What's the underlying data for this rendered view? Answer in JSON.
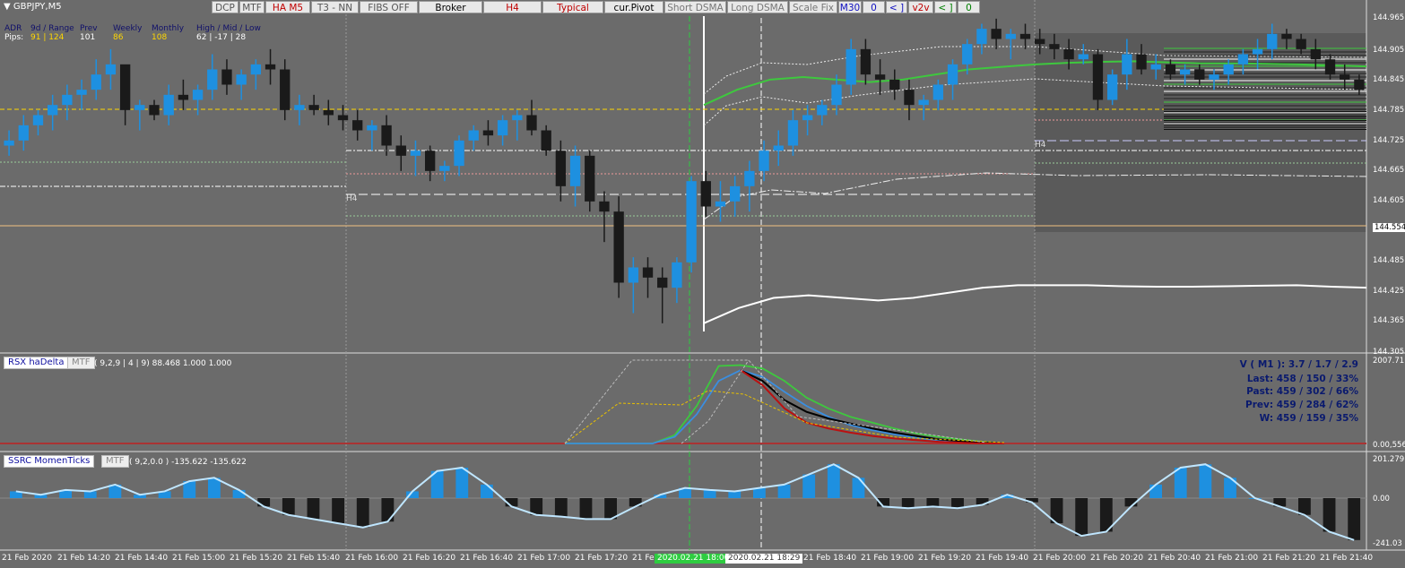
{
  "title": "GBPJPY,M5",
  "toolbar": [
    {
      "label": "DCP",
      "color": "#555555"
    },
    {
      "label": "MTF",
      "color": "#555555"
    },
    {
      "label": "HA M5",
      "color": "#c00000"
    },
    {
      "label": "T3 - NN",
      "color": "#555555"
    },
    {
      "label": "FIBS OFF",
      "color": "#555555"
    },
    {
      "label": "Broker",
      "color": "#000000"
    },
    {
      "label": "H4",
      "color": "#c00000"
    },
    {
      "label": "Typical",
      "color": "#c00000"
    },
    {
      "label": "cur.Pivot",
      "color": "#000000"
    },
    {
      "label": "Short DSMA",
      "color": "#777777"
    },
    {
      "label": "Long DSMA",
      "color": "#777777"
    },
    {
      "label": "Scale Fix",
      "color": "#777777"
    },
    {
      "label": "M30",
      "color": "#1010c0"
    },
    {
      "label": "0",
      "color": "#1010c0"
    },
    {
      "label": "< ]",
      "color": "#1010c0"
    },
    {
      "label": "v2v",
      "color": "#c00000"
    },
    {
      "label": "< ]",
      "color": "#008000"
    },
    {
      "label": "0",
      "color": "#008000"
    }
  ],
  "adr": {
    "row1": [
      "ADR",
      "9d / Range",
      "Prev",
      "Weekly",
      "Monthly",
      "High / Mid / Low"
    ],
    "row2": [
      "Pips:",
      "91 | 124",
      "101",
      "86",
      "108",
      "62 | -17 | 28"
    ]
  },
  "h4_labels": [
    "H4",
    "H4"
  ],
  "price_axis": [
    "144.965",
    "144.905",
    "144.845",
    "144.785",
    "144.725",
    "144.665",
    "144.605",
    "144.554",
    "144.485",
    "144.425",
    "144.365",
    "144.305"
  ],
  "rsx": {
    "label": "RSX haDelta",
    "mtf": "MTF",
    "params": "( 9,2,9 | 4 | 9) 88.468 1.000 1.000",
    "axis_top": "2007.711",
    "axis_bottom": "0.00,556",
    "stats": [
      "V ( M1 ): 3.7 / 1.7 / 2.9",
      "Last: 458 / 150 / 33%",
      "Past: 459 / 302 / 66%",
      "Prev: 459 / 284 / 62%",
      "W: 459 / 159 / 35%"
    ]
  },
  "ssrc": {
    "label": "SSRC MomenTicks",
    "mtf": "MTF",
    "params": "( 9,2,0.0 ) -135.622 -135.622",
    "axis": [
      "201.279",
      "0.00",
      "-241.03"
    ]
  },
  "time_axis": [
    "21 Feb 2020",
    "21 Feb 14:20",
    "21 Feb 14:40",
    "21 Feb 15:00",
    "21 Feb 15:20",
    "21 Feb 15:40",
    "21 Feb 16:00",
    "21 Feb 16:20",
    "21 Feb 16:40",
    "21 Feb 17:00",
    "21 Feb 17:20",
    "21 Feb",
    "21 Feb 18:40",
    "21 Feb 19:00",
    "21 Feb 19:20",
    "21 Feb 19:40",
    "21 Feb 20:00",
    "21 Feb 20:20",
    "21 Feb 20:40",
    "21 Feb 21:00",
    "21 Feb 21:20",
    "21 Feb 21:40"
  ],
  "time_markers": [
    "2020.02.21 18:00",
    "2020.02.21 18:29"
  ],
  "colors": {
    "bull": "#1e90e0",
    "bear": "#1a1a1a",
    "bg": "#6b6b6b",
    "dsma": "#3ec83e"
  },
  "chart_data": {
    "type": "line",
    "candles": [
      [
        144.71,
        144.74,
        144.69,
        144.72
      ],
      [
        144.72,
        144.77,
        144.7,
        144.75
      ],
      [
        144.75,
        144.78,
        144.73,
        144.77
      ],
      [
        144.77,
        144.81,
        144.74,
        144.79
      ],
      [
        144.79,
        144.83,
        144.76,
        144.81
      ],
      [
        144.81,
        144.84,
        144.78,
        144.82
      ],
      [
        144.82,
        144.88,
        144.8,
        144.85
      ],
      [
        144.85,
        144.9,
        144.82,
        144.87
      ],
      [
        144.87,
        144.86,
        144.75,
        144.78
      ],
      [
        144.78,
        144.8,
        144.74,
        144.79
      ],
      [
        144.79,
        144.8,
        144.76,
        144.77
      ],
      [
        144.77,
        144.83,
        144.75,
        144.81
      ],
      [
        144.81,
        144.84,
        144.78,
        144.8
      ],
      [
        144.8,
        144.83,
        144.77,
        144.82
      ],
      [
        144.82,
        144.89,
        144.8,
        144.86
      ],
      [
        144.86,
        144.88,
        144.81,
        144.83
      ],
      [
        144.83,
        144.86,
        144.8,
        144.85
      ],
      [
        144.85,
        144.88,
        144.82,
        144.87
      ],
      [
        144.87,
        144.9,
        144.83,
        144.86
      ],
      [
        144.86,
        144.88,
        144.76,
        144.78
      ],
      [
        144.78,
        144.81,
        144.75,
        144.79
      ],
      [
        144.79,
        144.81,
        144.77,
        144.78
      ],
      [
        144.78,
        144.8,
        144.75,
        144.77
      ],
      [
        144.77,
        144.79,
        144.74,
        144.76
      ],
      [
        144.76,
        144.78,
        144.72,
        144.74
      ],
      [
        144.74,
        144.76,
        144.7,
        144.75
      ],
      [
        144.75,
        144.77,
        144.69,
        144.71
      ],
      [
        144.71,
        144.73,
        144.66,
        144.69
      ],
      [
        144.69,
        144.72,
        144.65,
        144.7
      ],
      [
        144.7,
        144.71,
        144.64,
        144.66
      ],
      [
        144.66,
        144.68,
        144.64,
        144.67
      ],
      [
        144.67,
        144.73,
        144.65,
        144.72
      ],
      [
        144.72,
        144.75,
        144.7,
        144.74
      ],
      [
        144.74,
        144.76,
        144.71,
        144.73
      ],
      [
        144.73,
        144.77,
        144.71,
        144.76
      ],
      [
        144.76,
        144.78,
        144.72,
        144.77
      ],
      [
        144.77,
        144.8,
        144.73,
        144.74
      ],
      [
        144.74,
        144.75,
        144.69,
        144.7
      ],
      [
        144.7,
        144.72,
        144.6,
        144.63
      ],
      [
        144.63,
        144.71,
        144.59,
        144.69
      ],
      [
        144.69,
        144.7,
        144.58,
        144.6
      ],
      [
        144.6,
        144.62,
        144.52,
        144.58
      ],
      [
        144.58,
        144.61,
        144.41,
        144.44
      ],
      [
        144.44,
        144.49,
        144.38,
        144.47
      ],
      [
        144.47,
        144.49,
        144.41,
        144.45
      ],
      [
        144.45,
        144.47,
        144.36,
        144.43
      ],
      [
        144.43,
        144.49,
        144.4,
        144.48
      ],
      [
        144.48,
        144.65,
        144.46,
        144.64
      ],
      [
        144.64,
        144.66,
        144.57,
        144.59
      ],
      [
        144.59,
        144.64,
        144.56,
        144.6
      ],
      [
        144.6,
        144.65,
        144.57,
        144.63
      ],
      [
        144.63,
        144.68,
        144.58,
        144.66
      ],
      [
        144.66,
        144.72,
        144.64,
        144.7
      ],
      [
        144.7,
        144.74,
        144.67,
        144.71
      ],
      [
        144.71,
        144.78,
        144.69,
        144.76
      ],
      [
        144.76,
        144.79,
        144.73,
        144.77
      ],
      [
        144.77,
        144.8,
        144.75,
        144.79
      ],
      [
        144.79,
        144.85,
        144.77,
        144.83
      ],
      [
        144.83,
        144.92,
        144.81,
        144.9
      ],
      [
        144.9,
        144.92,
        144.83,
        144.85
      ],
      [
        144.85,
        144.88,
        144.81,
        144.84
      ],
      [
        144.84,
        144.86,
        144.8,
        144.82
      ],
      [
        144.82,
        144.84,
        144.76,
        144.79
      ],
      [
        144.79,
        144.81,
        144.76,
        144.8
      ],
      [
        144.8,
        144.84,
        144.78,
        144.83
      ],
      [
        144.83,
        144.88,
        144.8,
        144.87
      ],
      [
        144.87,
        144.92,
        144.85,
        144.91
      ],
      [
        144.91,
        144.95,
        144.89,
        144.94
      ],
      [
        144.94,
        144.96,
        144.9,
        144.92
      ],
      [
        144.92,
        144.94,
        144.88,
        144.93
      ],
      [
        144.93,
        144.95,
        144.9,
        144.92
      ],
      [
        144.92,
        144.94,
        144.89,
        144.91
      ],
      [
        144.91,
        144.93,
        144.88,
        144.9
      ],
      [
        144.9,
        144.92,
        144.86,
        144.88
      ],
      [
        144.88,
        144.91,
        144.87,
        144.89
      ],
      [
        144.89,
        144.9,
        144.78,
        144.8
      ],
      [
        144.8,
        144.86,
        144.79,
        144.85
      ],
      [
        144.85,
        144.92,
        144.82,
        144.89
      ],
      [
        144.89,
        144.91,
        144.85,
        144.86
      ],
      [
        144.86,
        144.89,
        144.84,
        144.87
      ],
      [
        144.87,
        144.88,
        144.84,
        144.85
      ],
      [
        144.85,
        144.87,
        144.83,
        144.86
      ],
      [
        144.86,
        144.87,
        144.83,
        144.84
      ],
      [
        144.84,
        144.86,
        144.82,
        144.85
      ],
      [
        144.85,
        144.88,
        144.83,
        144.87
      ],
      [
        144.87,
        144.9,
        144.85,
        144.89
      ],
      [
        144.89,
        144.92,
        144.86,
        144.9
      ],
      [
        144.9,
        144.95,
        144.88,
        144.93
      ],
      [
        144.93,
        144.94,
        144.9,
        144.92
      ],
      [
        144.92,
        144.93,
        144.89,
        144.9
      ],
      [
        144.9,
        144.92,
        144.86,
        144.88
      ],
      [
        144.88,
        144.89,
        144.84,
        144.85
      ],
      [
        144.85,
        144.87,
        144.82,
        144.84
      ],
      [
        144.84,
        144.85,
        144.81,
        144.82
      ]
    ],
    "price_range": [
      144.305,
      144.965
    ],
    "dsma": [
      144.79,
      144.82,
      144.84,
      144.845,
      144.84,
      144.835,
      144.84,
      144.85,
      144.86,
      144.865,
      144.87,
      144.873,
      144.875,
      144.876,
      144.874,
      144.872,
      144.872,
      144.871,
      144.87,
      144.868,
      144.866
    ],
    "lower_curve": [
      144.36,
      144.39,
      144.41,
      144.415,
      144.41,
      144.405,
      144.41,
      144.42,
      144.43,
      144.435,
      144.435,
      144.435,
      144.433,
      144.432,
      144.432,
      144.433,
      144.434,
      144.435,
      144.432,
      144.43
    ],
    "rsx_lines": {
      "green": [
        0,
        0,
        0,
        0,
        0,
        0.1,
        0.45,
        0.93,
        0.94,
        0.9,
        0.75,
        0.55,
        0.42,
        0.32,
        0.25,
        0.18,
        0.12,
        0.08,
        0.05,
        0.02,
        0
      ],
      "blue": [
        0,
        0,
        0,
        0,
        0,
        0.08,
        0.35,
        0.75,
        0.88,
        0.8,
        0.62,
        0.45,
        0.32,
        0.22,
        0.16,
        0.11,
        0.07,
        0.04,
        0.02,
        0.01,
        0
      ],
      "black": [
        0,
        0,
        0,
        0,
        0,
        0,
        0,
        0,
        0.88,
        0.75,
        0.52,
        0.38,
        0.3,
        0.24,
        0.18,
        0.13,
        0.09,
        0.05,
        0.03,
        0.01,
        0
      ],
      "red": [
        0,
        0,
        0,
        0,
        0,
        0,
        0,
        0,
        0.88,
        0.7,
        0.42,
        0.25,
        0.18,
        0.13,
        0.09,
        0.06,
        0.04,
        0.02,
        0.01,
        0,
        0
      ]
    },
    "ssrc_values": [
      0.1,
      0.05,
      0.12,
      0.1,
      0.2,
      0.05,
      0.1,
      0.25,
      0.3,
      0.12,
      -0.1,
      -0.2,
      -0.25,
      -0.3,
      -0.35,
      -0.28,
      0.1,
      0.4,
      0.45,
      0.2,
      -0.1,
      -0.2,
      -0.22,
      -0.25,
      -0.25,
      -0.1,
      0.05,
      0.15,
      0.12,
      0.1,
      0.15,
      0.2,
      0.35,
      0.5,
      0.3,
      -0.1,
      -0.12,
      -0.1,
      -0.12,
      -0.08,
      0.05,
      -0.05,
      -0.3,
      -0.45,
      -0.4,
      -0.1,
      0.2,
      0.45,
      0.5,
      0.3,
      0,
      -0.1,
      -0.2,
      -0.4,
      -0.5
    ]
  }
}
